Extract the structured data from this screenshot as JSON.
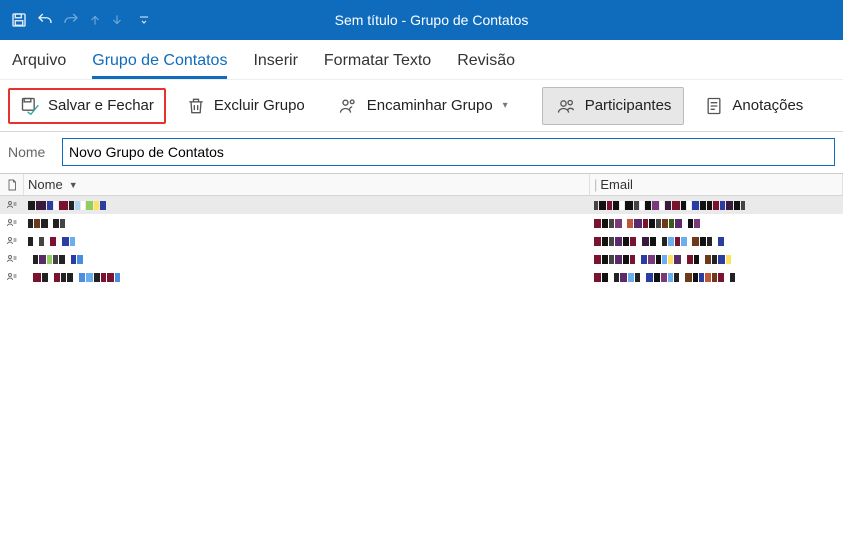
{
  "titlebar": {
    "title": "Sem título  -  Grupo de Contatos"
  },
  "tabs": {
    "arquivo": "Arquivo",
    "grupo": "Grupo de Contatos",
    "inserir": "Inserir",
    "formatar": "Formatar Texto",
    "revisao": "Revisão"
  },
  "toolbar": {
    "salvar": "Salvar e Fechar",
    "excluir": "Excluir Grupo",
    "encaminhar": "Encaminhar Grupo",
    "participantes": "Participantes",
    "anotacoes": "Anotações"
  },
  "name_field": {
    "label": "Nome",
    "value": "Novo Grupo de Contatos"
  },
  "grid": {
    "header_name": "Nome",
    "header_email": "Email"
  }
}
